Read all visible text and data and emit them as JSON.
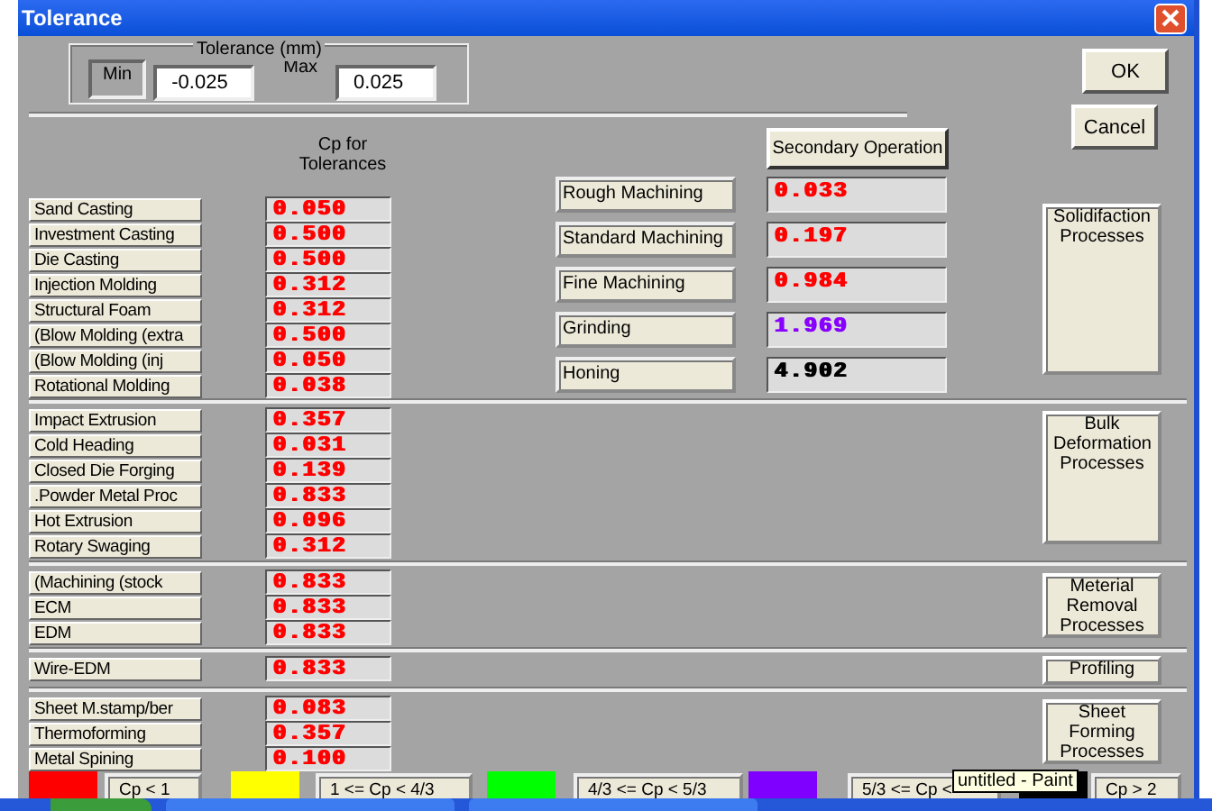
{
  "window": {
    "title": "Tolerance"
  },
  "tolerance": {
    "legend": "Tolerance (mm)",
    "min_label": "Min",
    "min_value": "-0.025",
    "max_label": "Max",
    "max_value": "0.025"
  },
  "buttons": [
    {
      "label": "OK"
    },
    {
      "label": "Cancel"
    }
  ],
  "cp_heading": "Cp for Tolerances",
  "secondary": {
    "heading": "Secondary Operation",
    "operations": [
      {
        "name": "Rough Machining",
        "value": "0.033",
        "color": "#ff0000"
      },
      {
        "name": "Standard Machining",
        "value": "0.197",
        "color": "#ff0000"
      },
      {
        "name": "Fine Machining",
        "value": "0.984",
        "color": "#ff0000"
      },
      {
        "name": "Grinding",
        "value": "1.969",
        "color": "#8800ff"
      },
      {
        "name": "Honing",
        "value": "4.902",
        "color": "#000000"
      }
    ]
  },
  "groups": [
    {
      "title": "Solidifaction Processes",
      "processes": [
        {
          "name": "Sand Casting",
          "value": "0.050",
          "color": "#ff0000"
        },
        {
          "name": "Investment Casting",
          "value": "0.500",
          "color": "#ff0000"
        },
        {
          "name": "Die Casting",
          "value": "0.500",
          "color": "#ff0000"
        },
        {
          "name": "Injection Molding",
          "value": "0.312",
          "color": "#ff0000"
        },
        {
          "name": "Structural Foam",
          "value": "0.312",
          "color": "#ff0000"
        },
        {
          "name": "(Blow Molding (extra",
          "value": "0.500",
          "color": "#ff0000"
        },
        {
          "name": "(Blow Molding (inj",
          "value": "0.050",
          "color": "#ff0000"
        },
        {
          "name": "Rotational Molding",
          "value": "0.038",
          "color": "#ff0000"
        }
      ]
    },
    {
      "title": "Bulk Deformation Processes",
      "processes": [
        {
          "name": "Impact Extrusion",
          "value": "0.357",
          "color": "#ff0000"
        },
        {
          "name": "Cold Heading",
          "value": "0.031",
          "color": "#ff0000"
        },
        {
          "name": "Closed Die Forging",
          "value": "0.139",
          "color": "#ff0000"
        },
        {
          "name": ".Powder Metal Proc",
          "value": "0.833",
          "color": "#ff0000"
        },
        {
          "name": "Hot Extrusion",
          "value": "0.096",
          "color": "#ff0000"
        },
        {
          "name": "Rotary Swaging",
          "value": "0.312",
          "color": "#ff0000"
        }
      ]
    },
    {
      "title": "Meterial Removal Processes",
      "processes": [
        {
          "name": "(Machining (stock",
          "value": "0.833",
          "color": "#ff0000"
        },
        {
          "name": "ECM",
          "value": "0.833",
          "color": "#ff0000"
        },
        {
          "name": "EDM",
          "value": "0.833",
          "color": "#ff0000"
        }
      ]
    },
    {
      "title": "Profiling",
      "processes": [
        {
          "name": "Wire-EDM",
          "value": "0.833",
          "color": "#ff0000"
        }
      ]
    },
    {
      "title": "Sheet Forming Processes",
      "processes": [
        {
          "name": "Sheet M.stamp/ber",
          "value": "0.083",
          "color": "#ff0000"
        },
        {
          "name": "Thermoforming",
          "value": "0.357",
          "color": "#ff0000"
        },
        {
          "name": "Metal Spining",
          "value": "0.100",
          "color": "#ff0000"
        }
      ]
    }
  ],
  "legend": [
    {
      "color": "#ff0000",
      "label": "Cp < 1"
    },
    {
      "color": "#ffff00",
      "label": "1 <= Cp < 4/3"
    },
    {
      "color": "#00ff00",
      "label": "4/3 <= Cp < 5/3"
    },
    {
      "color": "#8000ff",
      "label": "5/3 <= Cp <"
    },
    {
      "color": "#000000",
      "label": "Cp > 2"
    }
  ],
  "tooltip": "untitled - Paint"
}
